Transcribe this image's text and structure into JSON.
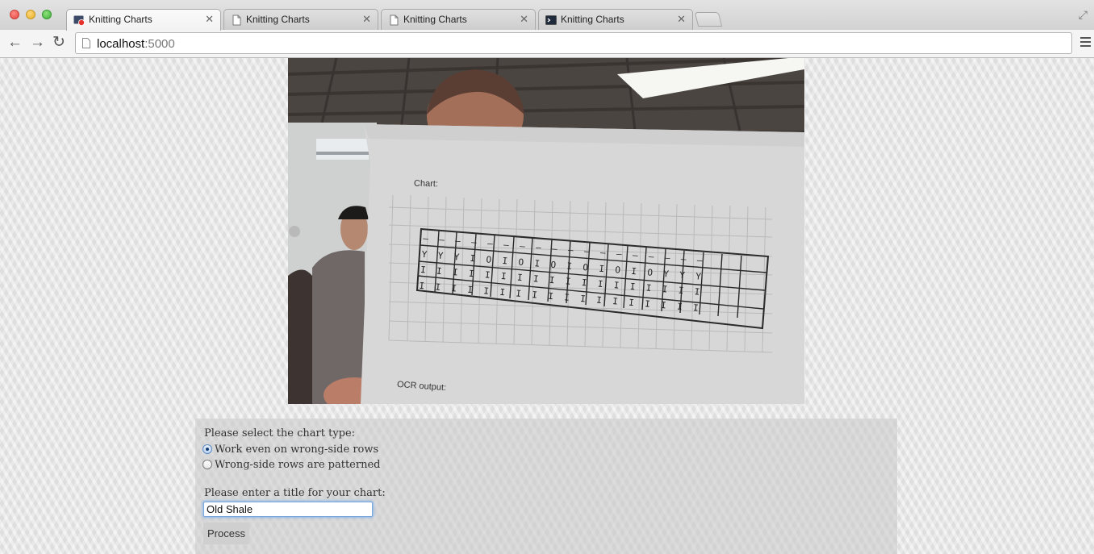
{
  "browser": {
    "tabs": [
      {
        "label": "Knitting Charts",
        "icon": "record-icon",
        "active": true
      },
      {
        "label": "Knitting Charts",
        "icon": "page-icon",
        "active": false
      },
      {
        "label": "Knitting Charts",
        "icon": "page-icon",
        "active": false
      },
      {
        "label": "Knitting Charts",
        "icon": "terminal-icon",
        "active": false
      }
    ],
    "address": {
      "host": "localhost",
      "port": ":5000"
    }
  },
  "camera_feed": {
    "paper_heading": "Chart:",
    "paper_footer": "OCR output:",
    "chart_rows": [
      "— — — — — — — — — — — — — — — — — —",
      "Y Y Y I O I O I O I O I O I O Y Y Y",
      "I I I I I I I I I I I I I I I I I I",
      "I I I I I I I I I I I I I I I I I I"
    ]
  },
  "form": {
    "chart_type_prompt": "Please select the chart type:",
    "options": [
      {
        "label": "Work even on wrong-side rows",
        "checked": true
      },
      {
        "label": "Wrong-side rows are patterned",
        "checked": false
      }
    ],
    "title_prompt": "Please enter a title for your chart:",
    "title_value": "Old Shale",
    "submit_label": "Process"
  }
}
